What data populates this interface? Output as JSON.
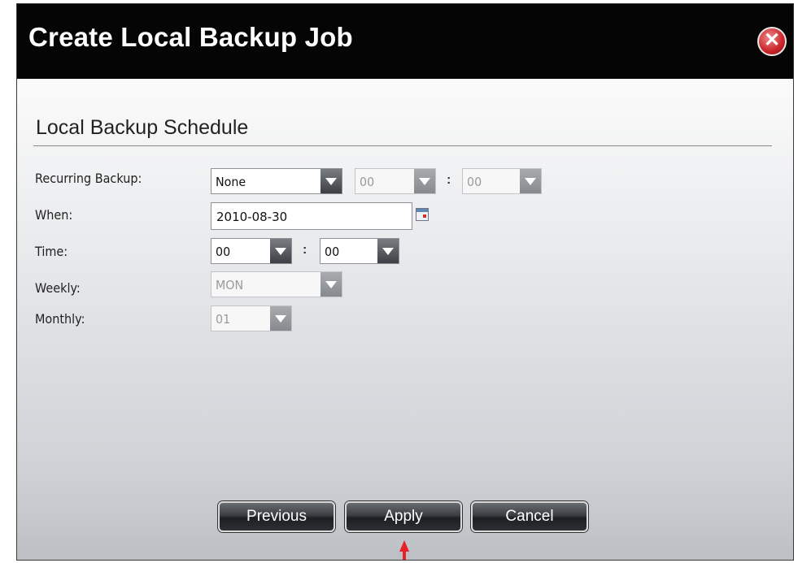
{
  "dialog": {
    "title": "Create Local Backup Job",
    "close_icon": "close-icon"
  },
  "schedule": {
    "section_title": "Local Backup Schedule",
    "recurring": {
      "label": "Recurring Backup:",
      "value": "None",
      "hour": "00",
      "minute": "00",
      "separator": ":"
    },
    "when": {
      "label": "When:",
      "value": "2010-08-30"
    },
    "time": {
      "label": "Time:",
      "hour": "00",
      "minute": "00",
      "separator": ":"
    },
    "weekly": {
      "label": "Weekly:",
      "value": "MON"
    },
    "monthly": {
      "label": "Monthly:",
      "value": "01"
    }
  },
  "buttons": {
    "previous": "Previous",
    "apply": "Apply",
    "cancel": "Cancel"
  },
  "colors": {
    "title_bar": "#050505",
    "close": "#c9242a",
    "pointer": "#e8202a"
  }
}
